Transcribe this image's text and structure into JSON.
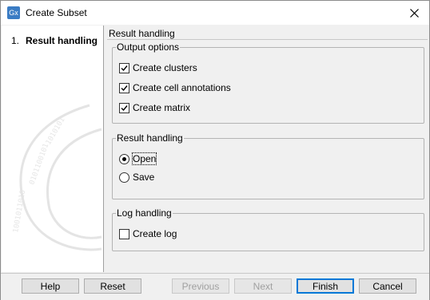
{
  "window": {
    "title": "Create Subset",
    "app_icon_label": "Gx",
    "close_icon": "close-icon"
  },
  "steps": [
    {
      "number": "1.",
      "label": "Result handling"
    }
  ],
  "panel": {
    "title": "Result handling"
  },
  "output_options": {
    "legend": "Output options",
    "items": [
      {
        "label": "Create clusters",
        "checked": true
      },
      {
        "label": "Create cell annotations",
        "checked": true
      },
      {
        "label": "Create matrix",
        "checked": true
      }
    ]
  },
  "result_handling": {
    "legend": "Result handling",
    "options": [
      {
        "label": "Open",
        "selected": true
      },
      {
        "label": "Save",
        "selected": false
      }
    ]
  },
  "log_handling": {
    "legend": "Log handling",
    "items": [
      {
        "label": "Create log",
        "checked": false
      }
    ]
  },
  "buttons": {
    "help": "Help",
    "reset": "Reset",
    "previous": "Previous",
    "next": "Next",
    "finish": "Finish",
    "cancel": "Cancel"
  },
  "colors": {
    "accent": "#0078d7",
    "check": "#000000"
  }
}
